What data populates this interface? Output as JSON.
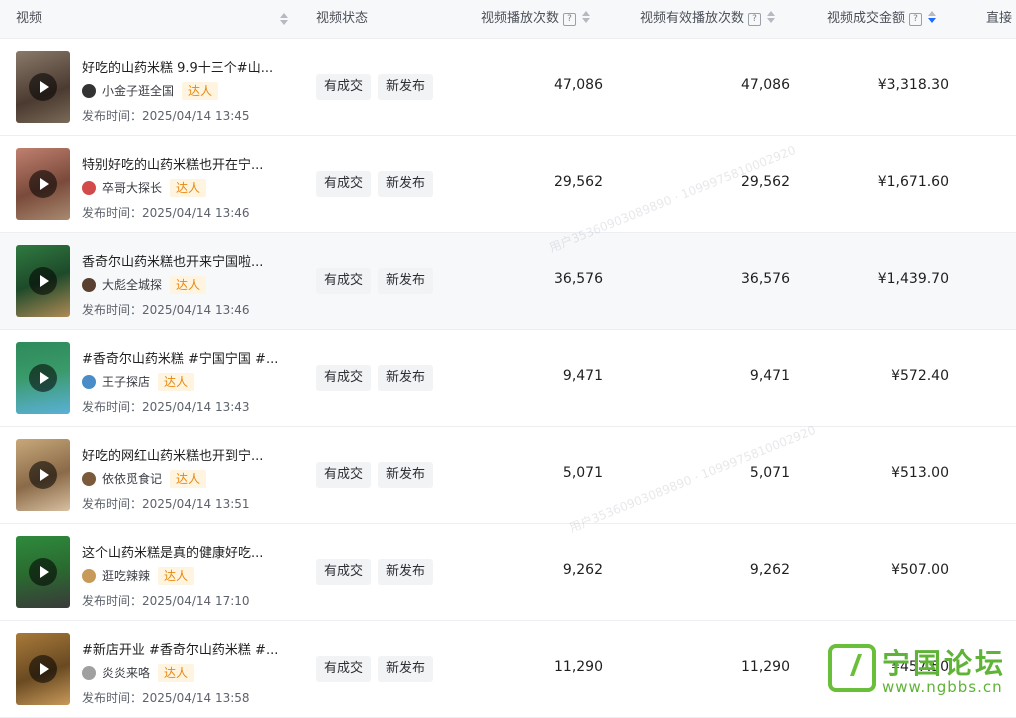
{
  "columns": {
    "video": "视频",
    "status": "视频状态",
    "plays": "视频播放次数",
    "valid_plays": "视频有效播放次数",
    "gmv": "视频成交金额",
    "direct": "直接"
  },
  "help_glyph": "?",
  "rows": [
    {
      "title": "好吃的山药米糕 9.9十三个#山...",
      "author": "小金子逛全国",
      "badge": "达人",
      "time": "发布时间：2025/04/14 13:45",
      "tag1": "有成交",
      "tag2": "新发布",
      "plays": "47,086",
      "valid_plays": "47,086",
      "gmv": "¥3,318.30",
      "thumb_color": "#6b5a4c",
      "avatar_color": "#333333"
    },
    {
      "title": "特别好吃的山药米糕也开在宁...",
      "author": "卒哥大探长",
      "badge": "达人",
      "time": "发布时间：2025/04/14 13:46",
      "tag1": "有成交",
      "tag2": "新发布",
      "plays": "29,562",
      "valid_plays": "29,562",
      "gmv": "¥1,671.60",
      "thumb_color": "#9a6a55",
      "avatar_color": "#d24a4a"
    },
    {
      "title": "香奇尔山药米糕也开来宁国啦...",
      "author": "大彪全城探",
      "badge": "达人",
      "time": "发布时间：2025/04/14 13:46",
      "tag1": "有成交",
      "tag2": "新发布",
      "plays": "36,576",
      "valid_plays": "36,576",
      "gmv": "¥1,439.70",
      "thumb_color": "#3e7a4a",
      "avatar_color": "#5a4030"
    },
    {
      "title": "#香奇尔山药米糕 #宁国宁国 #...",
      "author": "王子探店",
      "badge": "达人",
      "time": "发布时间：2025/04/14 13:43",
      "tag1": "有成交",
      "tag2": "新发布",
      "plays": "9,471",
      "valid_plays": "9,471",
      "gmv": "¥572.40",
      "thumb_color": "#3f8c6a",
      "avatar_color": "#4a8cc8"
    },
    {
      "title": "好吃的网红山药米糕也开到宁...",
      "author": "依依觅食记",
      "badge": "达人",
      "time": "发布时间：2025/04/14 13:51",
      "tag1": "有成交",
      "tag2": "新发布",
      "plays": "5,071",
      "valid_plays": "5,071",
      "gmv": "¥513.00",
      "thumb_color": "#b59a72",
      "avatar_color": "#7a5a3a"
    },
    {
      "title": "这个山药米糕是真的健康好吃...",
      "author": "逛吃辣辣",
      "badge": "达人",
      "time": "发布时间：2025/04/14 17:10",
      "tag1": "有成交",
      "tag2": "新发布",
      "plays": "9,262",
      "valid_plays": "9,262",
      "gmv": "¥507.00",
      "thumb_color": "#3a7a3c",
      "avatar_color": "#c89a5a"
    },
    {
      "title": "#新店开业 #香奇尔山药米糕 #...",
      "author": "炎炎来咯",
      "badge": "达人",
      "time": "发布时间：2025/04/14 13:58",
      "tag1": "有成交",
      "tag2": "新发布",
      "plays": "11,290",
      "valid_plays": "11,290",
      "gmv": "¥457.50",
      "thumb_color": "#8a6a3a",
      "avatar_color": "#a0a0a0"
    }
  ],
  "logo": {
    "cn": "宁国论坛",
    "en": "www.ngbbs.cn",
    "color": "#5fb336"
  },
  "watermark": "用户35360903089890 · 1099975810002920"
}
